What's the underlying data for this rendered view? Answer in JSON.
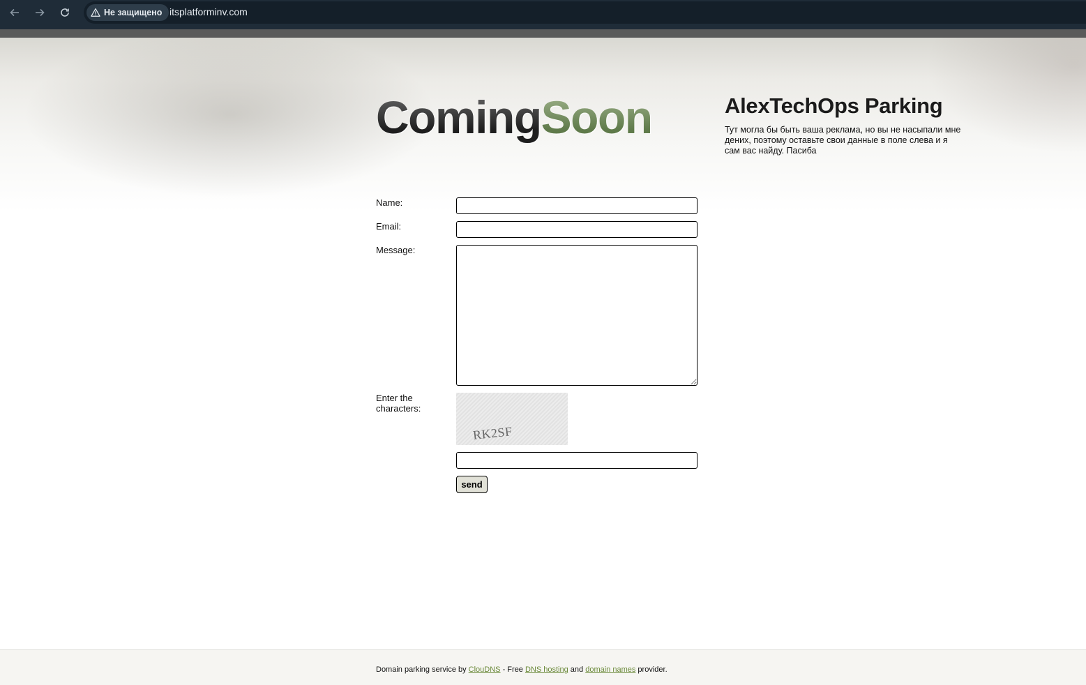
{
  "browser": {
    "security_label": "Не защищено",
    "url": "itsplatforminv.com",
    "back_icon": "arrow-left",
    "forward_icon": "arrow-right",
    "reload_icon": "reload",
    "warning_icon": "warning-triangle"
  },
  "header": {
    "logo_part1": "Coming",
    "logo_part2": "Soon",
    "logo_colors": {
      "part1": "#2a2a2a",
      "part2": "#6f8a58"
    }
  },
  "sidebar": {
    "title": "AlexTechOps Parking",
    "text": "Тут могла бы быть ваша реклама, но вы не насыпали мне дених, поэтому оставьте свои данные в поле слева и я сам вас найду. Пасиба"
  },
  "form": {
    "name_label": "Name:",
    "email_label": "Email:",
    "message_label": "Message:",
    "captcha_label": "Enter the characters:",
    "captcha_text": "RK2SF",
    "name_value": "",
    "email_value": "",
    "message_value": "",
    "captcha_value": "",
    "send_label": "send"
  },
  "footer": {
    "prefix": "Domain parking service by ",
    "link1": "ClouDNS",
    "middle1": " - Free ",
    "link2": "DNS hosting",
    "middle2": " and ",
    "link3": "domain names",
    "suffix": " provider.",
    "link_color": "#6b8a3a"
  }
}
